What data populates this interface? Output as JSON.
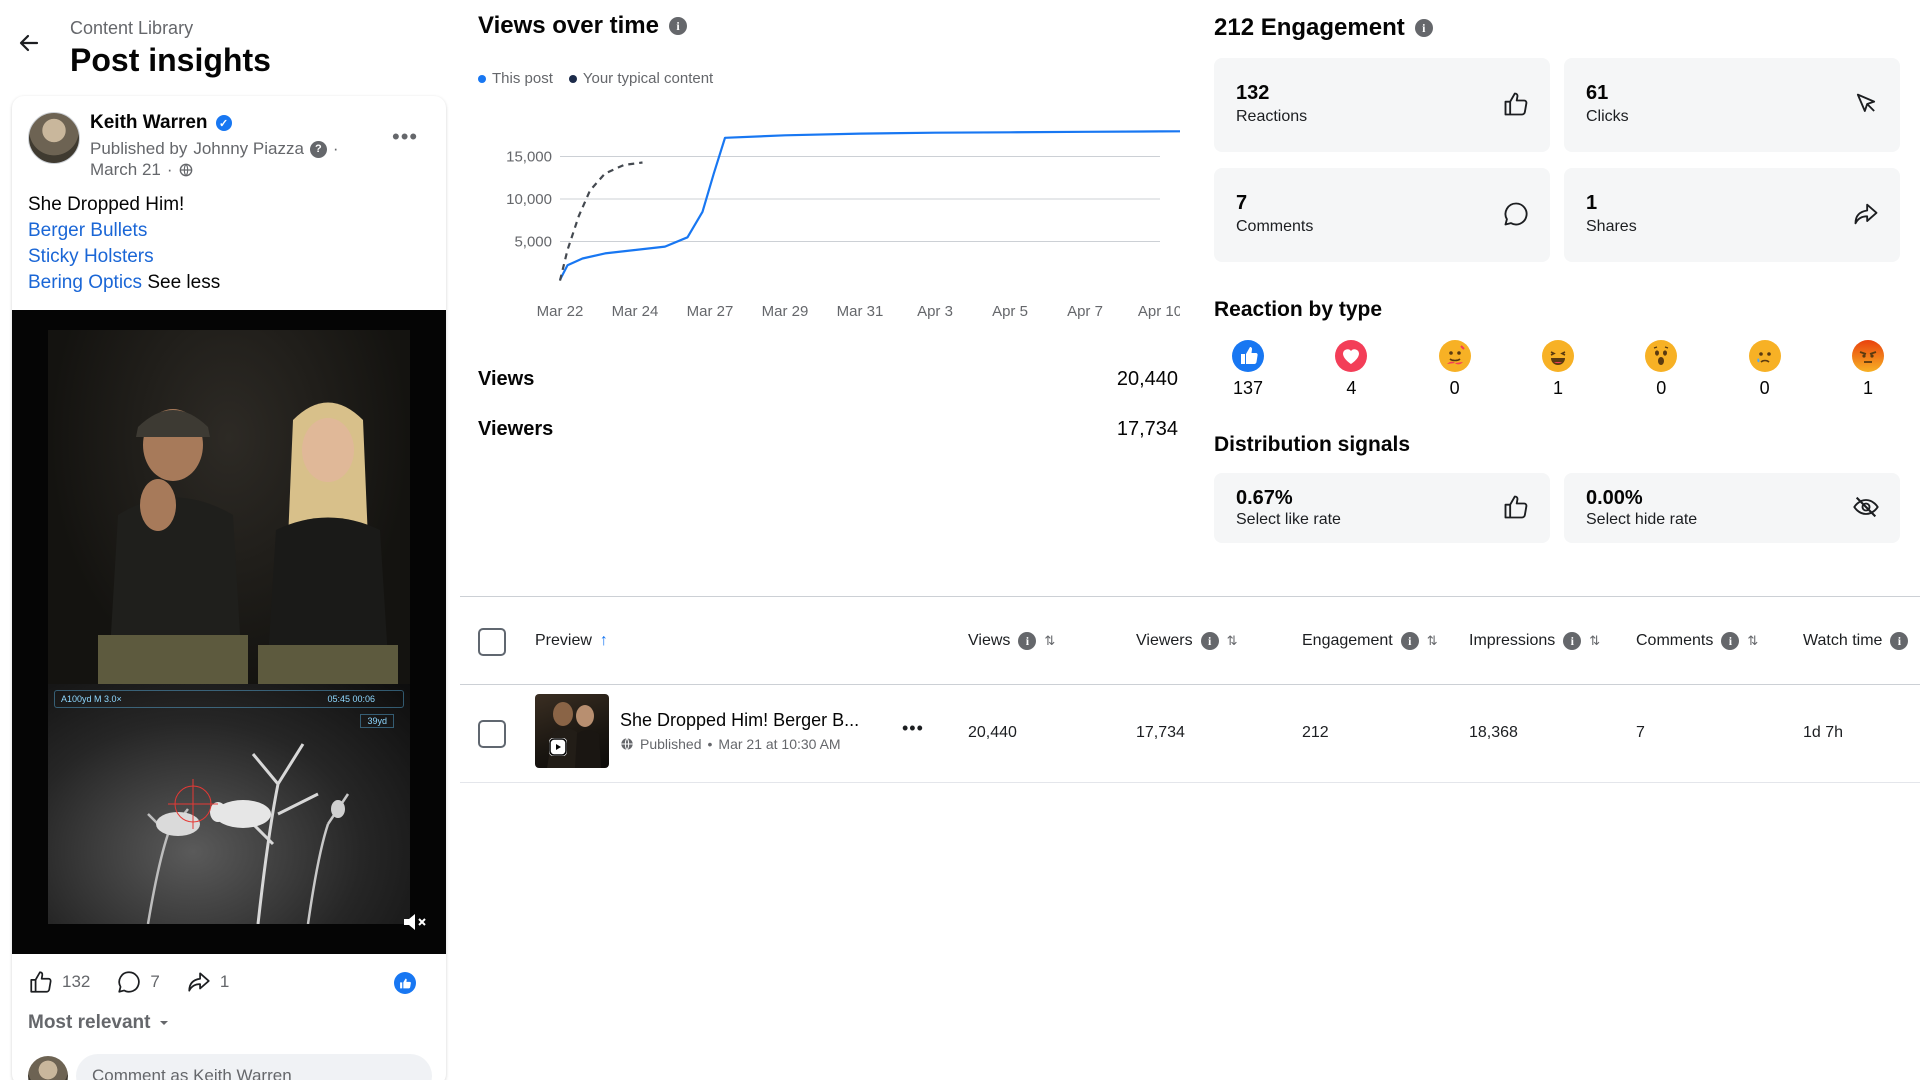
{
  "header": {
    "breadcrumb": "Content Library",
    "title": "Post insights"
  },
  "post": {
    "author": "Keith Warren",
    "published_prefix": "Published by",
    "publisher": "Johnny Piazza",
    "date": "March 21",
    "more": "•••",
    "text_line1": "She Dropped Him!",
    "link1": "Berger Bullets",
    "link2": "Sticky Holsters",
    "link3": "Bering Optics",
    "see_less": "See less",
    "hud_text": "A100yd  M 3.0×",
    "hud_time": "05:45  00:06",
    "hud_dist": "39yd",
    "likes": "132",
    "comments": "7",
    "shares": "1",
    "sort_label": "Most relevant",
    "comment_placeholder": "Comment as Keith Warren"
  },
  "views_over_time": {
    "title": "Views over time",
    "legend_this": "This post",
    "legend_typical": "Your typical content",
    "views_label": "Views",
    "views_value": "20,440",
    "viewers_label": "Viewers",
    "viewers_value": "17,734"
  },
  "chart_data": {
    "type": "line",
    "x_labels": [
      "Mar 22",
      "Mar 24",
      "Mar 27",
      "Mar 29",
      "Mar 31",
      "Apr 3",
      "Apr 5",
      "Apr 7",
      "Apr 10"
    ],
    "y_ticks": [
      "5,000",
      "10,000",
      "15,000"
    ],
    "ylim": [
      0,
      20000
    ],
    "series": [
      {
        "name": "This post",
        "color": "#1877f2",
        "style": "solid",
        "points": [
          [
            0,
            500
          ],
          [
            0.1,
            2200
          ],
          [
            0.3,
            3000
          ],
          [
            0.6,
            3600
          ],
          [
            1.0,
            4000
          ],
          [
            1.4,
            4400
          ],
          [
            1.7,
            5500
          ],
          [
            1.9,
            8500
          ],
          [
            2.05,
            13000
          ],
          [
            2.2,
            17200
          ],
          [
            3,
            17500
          ],
          [
            4,
            17700
          ],
          [
            5,
            17800
          ],
          [
            6,
            17850
          ],
          [
            7,
            17900
          ],
          [
            8,
            17950
          ],
          [
            9,
            18000
          ]
        ]
      },
      {
        "name": "Your typical content",
        "color": "#444950",
        "style": "dashed",
        "points": [
          [
            0,
            400
          ],
          [
            0.1,
            4000
          ],
          [
            0.25,
            8000
          ],
          [
            0.4,
            11000
          ],
          [
            0.6,
            13000
          ],
          [
            0.85,
            14000
          ],
          [
            1.1,
            14300
          ]
        ]
      }
    ]
  },
  "engagement": {
    "title": "212 Engagement",
    "cards": [
      {
        "num": "132",
        "label": "Reactions"
      },
      {
        "num": "61",
        "label": "Clicks"
      },
      {
        "num": "7",
        "label": "Comments"
      },
      {
        "num": "1",
        "label": "Shares"
      }
    ],
    "reaction_title": "Reaction by type",
    "reactions": [
      {
        "type": "like",
        "count": "137"
      },
      {
        "type": "love",
        "count": "4"
      },
      {
        "type": "care",
        "count": "0"
      },
      {
        "type": "haha",
        "count": "1"
      },
      {
        "type": "wow",
        "count": "0"
      },
      {
        "type": "sad",
        "count": "0"
      },
      {
        "type": "angry",
        "count": "1"
      }
    ],
    "distribution_title": "Distribution signals",
    "signals": [
      {
        "num": "0.67%",
        "label": "Select like rate"
      },
      {
        "num": "0.00%",
        "label": "Select hide rate"
      }
    ]
  },
  "table": {
    "headers": [
      "Preview",
      "Views",
      "Viewers",
      "Engagement",
      "Impressions",
      "Comments",
      "Watch time"
    ],
    "row": {
      "title": "She Dropped Him! Berger B...",
      "status": "Published",
      "date": "Mar 21 at 10:30 AM",
      "more": "•••",
      "views": "20,440",
      "viewers": "17,734",
      "engagement": "212",
      "impressions": "18,368",
      "comments": "7",
      "watch_time": "1d 7h"
    }
  },
  "colors": {
    "accent": "#1877f2",
    "link": "#1a66d6"
  }
}
